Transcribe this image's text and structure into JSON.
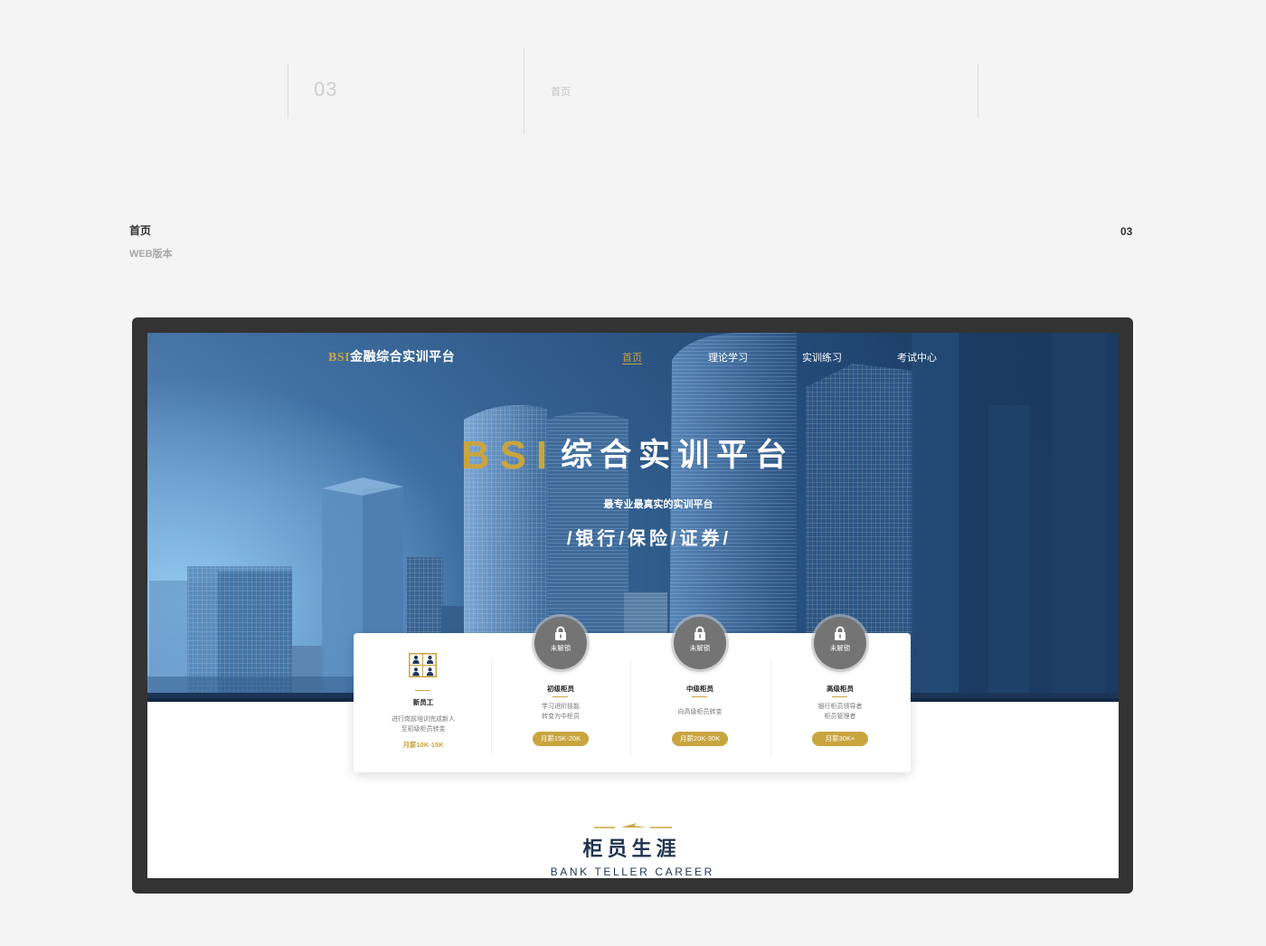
{
  "header": {
    "number": "03",
    "title": "首页"
  },
  "section": {
    "title": "首页",
    "subtitle": "WEB版本",
    "number": "03"
  },
  "site": {
    "logo": {
      "brand": "BSI",
      "name": "金融综合实训平台"
    },
    "nav": [
      {
        "label": "首页",
        "active": true
      },
      {
        "label": "理论学习",
        "active": false
      },
      {
        "label": "实训练习",
        "active": false
      },
      {
        "label": "考试中心",
        "active": false
      }
    ],
    "hero": {
      "brand": "BSI",
      "title": "综合实训平台",
      "subtitle": "最专业最真实的实训平台",
      "tagline": "/银行/保险/证券/"
    },
    "careers": [
      {
        "title": "新员工",
        "desc": [
          "进行岗前培训完成新人",
          "至初级柜员转变"
        ],
        "salary": "月薪10K-15K",
        "locked": false,
        "icon": "team-icon"
      },
      {
        "title": "初级柜员",
        "desc": [
          "学习进阶技能",
          "转变为中柜员"
        ],
        "salary": "月薪15K-20K",
        "locked": true,
        "lock_label": "未解锁",
        "icon": "lock-icon"
      },
      {
        "title": "中级柜员",
        "desc": [
          "向高级柜员转变"
        ],
        "salary": "月薪20K-30K",
        "locked": true,
        "lock_label": "未解锁",
        "icon": "lock-icon"
      },
      {
        "title": "高级柜员",
        "desc": [
          "银行柜员领导者",
          "柜员管理者"
        ],
        "salary": "月薪30K+",
        "locked": true,
        "lock_label": "未解锁",
        "icon": "lock-icon"
      }
    ],
    "career_section": {
      "title": "柜员生涯",
      "subtitle": "BANK TELLER CAREER"
    }
  },
  "colors": {
    "gold": "#c9a53f",
    "navy": "#1f3350",
    "background": "#f4f4f4",
    "frame": "#333333"
  }
}
